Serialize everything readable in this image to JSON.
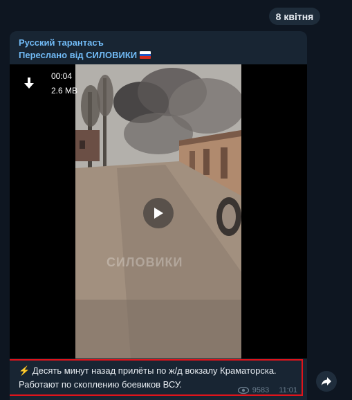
{
  "date_label": "8 квітня",
  "message": {
    "sender": "Русский тарантасъ",
    "forwarded_from": "Переслано від СИЛОВИКИ",
    "flag_colors": [
      "#ffffff",
      "#1c57c8",
      "#d52b1e"
    ],
    "video": {
      "duration": "00:04",
      "size": "2.6 MB",
      "watermark": "СИЛОВИКИ"
    },
    "caption_line1": "⚡️ Десять минут назад прилёты по ж/д вокзалу Краматорска.",
    "caption_line2": "Работают по скоплению боевиков ВСУ.",
    "views": "9583",
    "time": "11:01"
  },
  "colors": {
    "background": "#0e1621",
    "bubble": "#182533",
    "link": "#71baf5",
    "highlight_border": "#e0141b"
  },
  "icons": {
    "download": "download-icon",
    "play": "play-icon",
    "views": "eye-icon",
    "share": "share-arrow-icon"
  }
}
